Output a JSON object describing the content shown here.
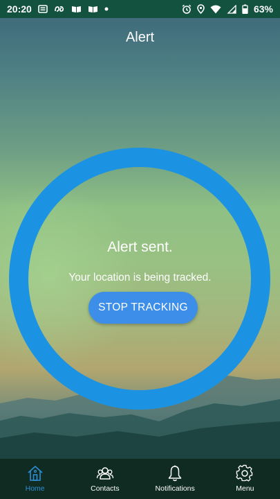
{
  "status_bar": {
    "time": "20:20",
    "battery": "63%",
    "notification_icons": [
      "news-icon",
      "sim-icon",
      "book-icon",
      "book-icon",
      "dot-icon"
    ],
    "system_icons": [
      "alarm-icon",
      "location-icon",
      "wifi-icon",
      "signal-icon",
      "battery-icon"
    ]
  },
  "header": {
    "title": "Alert"
  },
  "alert": {
    "title": "Alert sent.",
    "subtitle": "Your location is being tracked.",
    "stop_button_label": "STOP TRACKING"
  },
  "colors": {
    "status_bar": "#13523f",
    "ring": "#1c93e2",
    "button": "#3d8ee8",
    "nav_background": "#0f2b22",
    "nav_active": "#2f8fd6",
    "text": "#ffffff"
  },
  "bottom_nav": {
    "items": [
      {
        "label": "Home",
        "icon": "home-icon",
        "active": true
      },
      {
        "label": "Contacts",
        "icon": "contacts-icon",
        "active": false
      },
      {
        "label": "Notifications",
        "icon": "bell-icon",
        "active": false
      },
      {
        "label": "Menu",
        "icon": "gear-icon",
        "active": false
      }
    ]
  }
}
